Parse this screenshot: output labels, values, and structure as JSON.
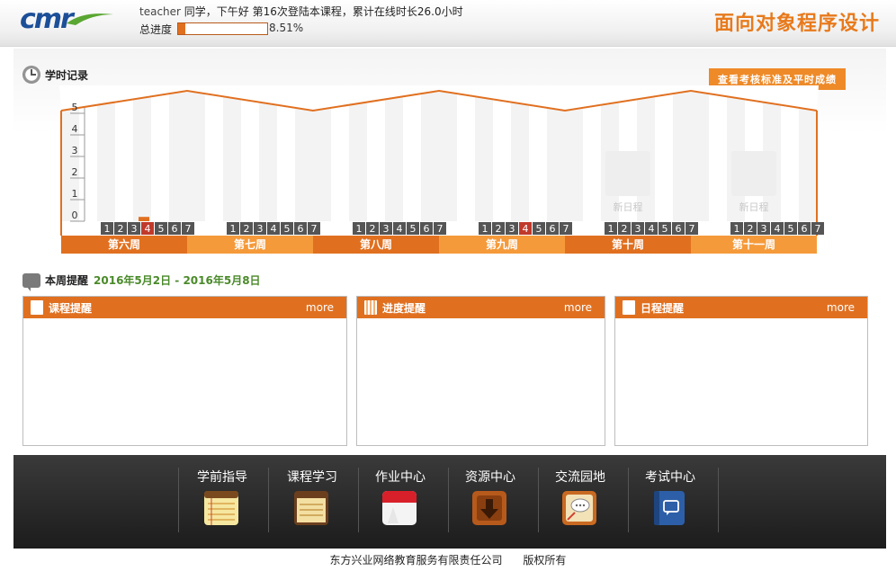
{
  "header": {
    "user": "teacher",
    "greeting_rest": " 同学，下午好  第16次登陆本课程，累计在线时长26.0小时",
    "progress_label": "总进度",
    "progress_value": 0.0851,
    "progress_text": "8.51%",
    "course_title": "面向对象程序设计",
    "logo_text": "cmr"
  },
  "study_record": {
    "title": "学时记录",
    "score_button": "查看考核标准及平时成绩",
    "y_ticks": [
      "5",
      "4",
      "3",
      "2",
      "1",
      "0"
    ],
    "day_labels": [
      "1",
      "2",
      "3",
      "4",
      "5",
      "6",
      "7"
    ],
    "weeks": [
      {
        "label": "第六周",
        "highlight_day": 4,
        "bar_day": 4,
        "bar_hours": 0.2,
        "new_schedule": null
      },
      {
        "label": "第七周",
        "highlight_day": null,
        "bar_day": null,
        "bar_hours": 0,
        "new_schedule": null
      },
      {
        "label": "第八周",
        "highlight_day": null,
        "bar_day": null,
        "bar_hours": 0,
        "new_schedule": null
      },
      {
        "label": "第九周",
        "highlight_day": 4,
        "bar_day": null,
        "bar_hours": 0,
        "new_schedule": null
      },
      {
        "label": "第十周",
        "highlight_day": null,
        "bar_day": null,
        "bar_hours": 0,
        "new_schedule": "新日程"
      },
      {
        "label": "第十一周",
        "highlight_day": null,
        "bar_day": null,
        "bar_hours": 0,
        "new_schedule": "新日程"
      }
    ],
    "colors": {
      "accent": "#e07020",
      "accent_light": "#f59a3a",
      "day_box": "#555555",
      "day_today": "#c0392b"
    }
  },
  "reminder": {
    "title": "本周提醒",
    "date_range": "2016年5月2日  - 2016年5月8日",
    "panels": [
      {
        "title": "课程提醒",
        "more": "more"
      },
      {
        "title": "进度提醒",
        "more": "more"
      },
      {
        "title": "日程提醒",
        "more": "more"
      }
    ]
  },
  "nav": [
    {
      "label": "学前指导",
      "icon": "notepad-icon"
    },
    {
      "label": "课程学习",
      "icon": "book-notes-icon"
    },
    {
      "label": "作业中心",
      "icon": "calendar-icon"
    },
    {
      "label": "资源中心",
      "icon": "download-icon"
    },
    {
      "label": "交流园地",
      "icon": "chat-board-icon"
    },
    {
      "label": "考试中心",
      "icon": "notebook-chat-icon"
    }
  ],
  "footer": {
    "text": "东方兴业网络教育服务有限责任公司      版权所有"
  }
}
